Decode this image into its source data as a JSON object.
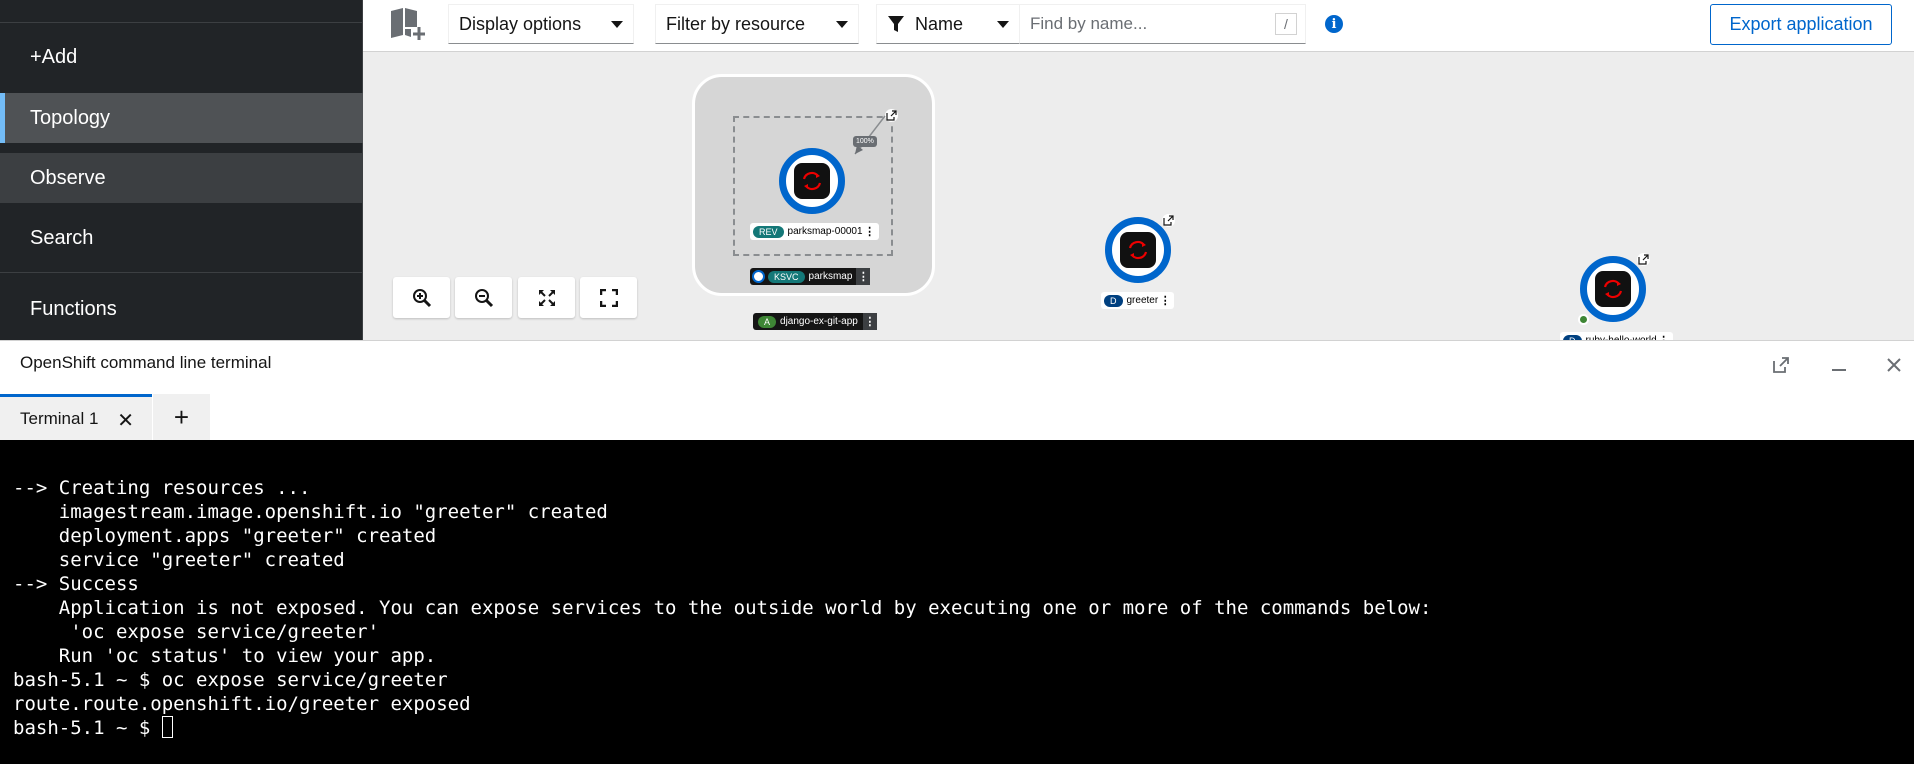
{
  "sidebar": {
    "items": [
      {
        "label": "+Add"
      },
      {
        "label": "Topology"
      },
      {
        "label": "Observe"
      },
      {
        "label": "Search"
      },
      {
        "label": "Functions"
      }
    ]
  },
  "toolbar": {
    "display_options": "Display options",
    "filter_by_resource": "Filter by resource",
    "filter_type": "Name",
    "search_placeholder": "Find by name...",
    "search_shortcut": "/",
    "export_label": "Export application"
  },
  "topology": {
    "traffic_percent": "100%",
    "revision": {
      "badge": "REV",
      "name": "parksmap-00001"
    },
    "service": {
      "badge": "KSVC",
      "name": "parksmap"
    },
    "application": {
      "badge": "A",
      "name": "django-ex-git-app"
    },
    "deployment": {
      "badge": "D",
      "name": "greeter"
    },
    "deployment2": {
      "badge": "D",
      "name": "ruby-hello-world"
    }
  },
  "terminal": {
    "panel_title": "OpenShift command line terminal",
    "tab_label": "Terminal 1",
    "lines": [
      "--> Creating resources ...",
      "    imagestream.image.openshift.io \"greeter\" created",
      "    deployment.apps \"greeter\" created",
      "    service \"greeter\" created",
      "--> Success",
      "    Application is not exposed. You can expose services to the outside world by executing one or more of the commands below:",
      "     'oc expose service/greeter'",
      "    Run 'oc status' to view your app.",
      "bash-5.1 ~ $ oc expose service/greeter",
      "route.route.openshift.io/greeter exposed"
    ],
    "prompt": "bash-5.1 ~ $ "
  },
  "colors": {
    "accent": "#0066cc",
    "sidebar_bg": "#212427",
    "terminal_bg": "#000000"
  }
}
